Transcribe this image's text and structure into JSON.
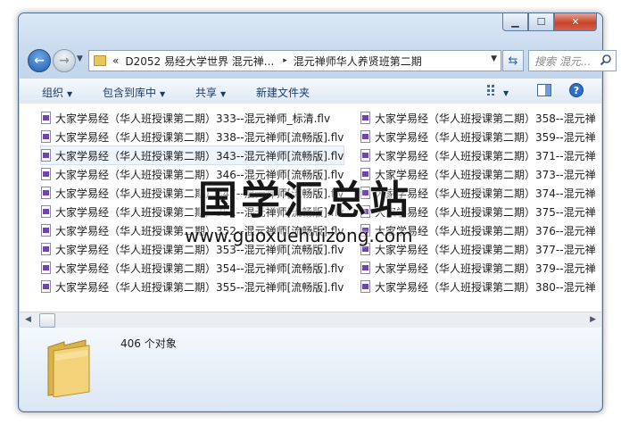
{
  "window": {
    "minimize_label": "▁",
    "maximize_label": "☐",
    "close_label": "✕"
  },
  "nav": {
    "breadcrumb": {
      "overflow": "«",
      "segment1": "D2052 易经大学世界 混元禅...",
      "separator": "▸",
      "segment2": "混元禅师华人养贤班第二期"
    },
    "search_placeholder": "搜索 混元..."
  },
  "toolbar": {
    "organize": "组织",
    "include_in_library": "包含到库中",
    "share": "共享",
    "new_folder": "新建文件夹"
  },
  "files_left": [
    "大家学易经（华人班授课第二期）333--混元禅师_标清.flv",
    "大家学易经（华人班授课第二期）338--混元禅师[流畅版].flv",
    "大家学易经（华人班授课第二期）343--混元禅师[流畅版].flv",
    "大家学易经（华人班授课第二期）346--混元禅师[流畅版].flv",
    "大家学易经（华人班授课第二期）347--混元禅师[流畅版].flv",
    "大家学易经（华人班授课第二期）351--混元禅师[流畅版].flv",
    "大家学易经（华人班授课第二期）352--混元禅师[流畅版].flv",
    "大家学易经（华人班授课第二期）353--混元禅师[流畅版].flv",
    "大家学易经（华人班授课第二期）354--混元禅师[流畅版].flv",
    "大家学易经（华人班授课第二期）355--混元禅师[流畅版].flv"
  ],
  "files_right": [
    "大家学易经（华人班授课第二期）358--混元禅",
    "大家学易经（华人班授课第二期）359--混元禅",
    "大家学易经（华人班授课第二期）371--混元禅",
    "大家学易经（华人班授课第二期）373--混元禅",
    "大家学易经（华人班授课第二期）374--混元禅",
    "大家学易经（华人班授课第二期）375--混元禅",
    "大家学易经（华人班授课第二期）376--混元禅",
    "大家学易经（华人班授课第二期）377--混元禅",
    "大家学易经（华人班授课第二期）379--混元禅",
    "大家学易经（华人班授课第二期）380--混元禅"
  ],
  "status": {
    "item_count": "406 个对象"
  },
  "watermark": {
    "title": "国学汇总站",
    "url": "www.guoxuehuizong.com"
  },
  "colors": {
    "frame": "#c3d6ec",
    "toolbar_text": "#1e3c64",
    "video_icon": "#7044a8",
    "close_button": "#c7442b",
    "folder": "#e9c65a"
  }
}
